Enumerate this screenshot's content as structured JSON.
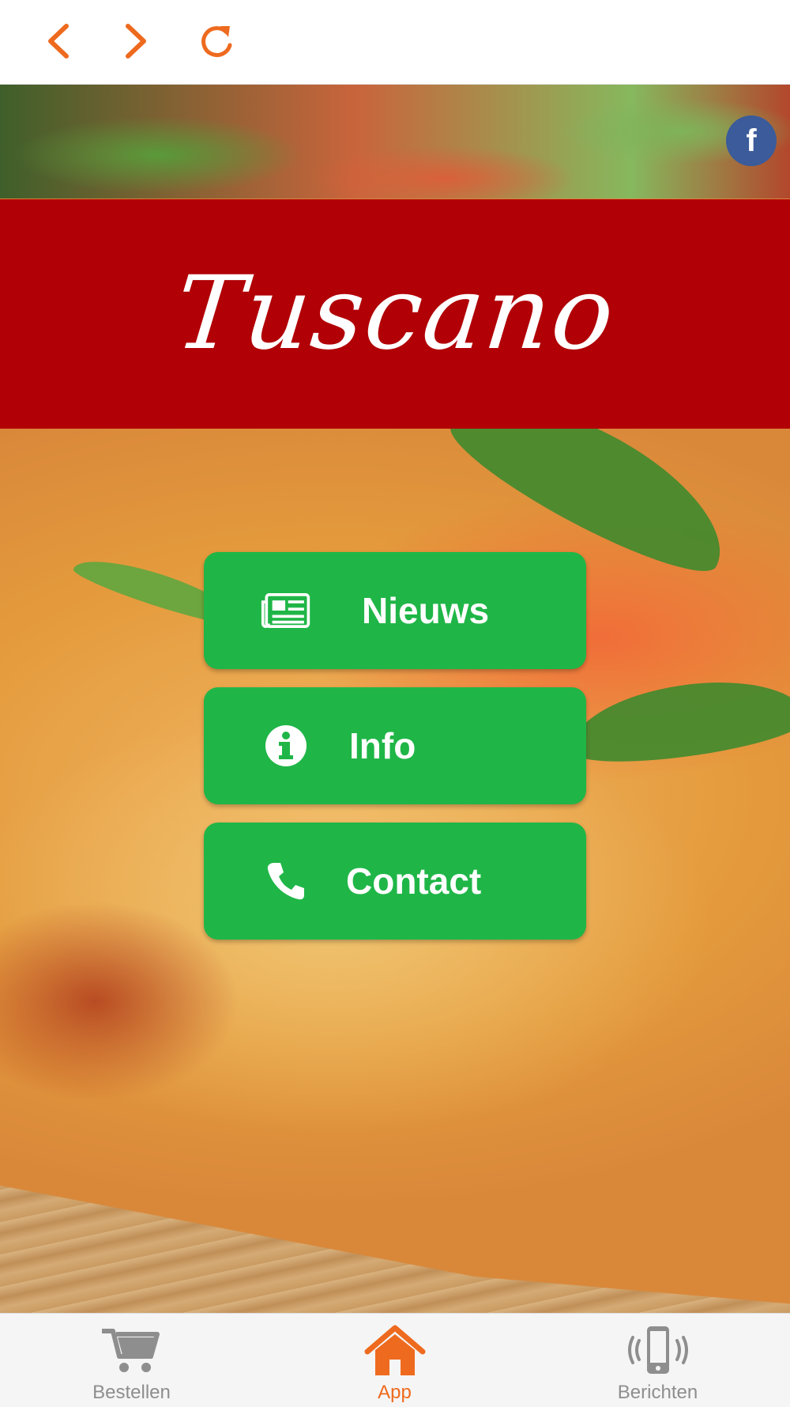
{
  "nav": {
    "back_icon": "chevron-left-icon",
    "forward_icon": "chevron-right-icon",
    "reload_icon": "reload-icon",
    "accent_color": "#ee6a1e"
  },
  "social": {
    "facebook_icon": "facebook-icon",
    "facebook_glyph": "f",
    "color": "#3b5b9a"
  },
  "brand": {
    "name": "Tuscano",
    "banner_color": "#b10006"
  },
  "menu": {
    "button_color": "#1fb647",
    "items": [
      {
        "label": "Nieuws",
        "icon": "newspaper-icon"
      },
      {
        "label": "Info",
        "icon": "info-icon"
      },
      {
        "label": "Contact",
        "icon": "phone-icon"
      }
    ]
  },
  "tabbar": {
    "items": [
      {
        "label": "Bestellen",
        "icon": "cart-icon",
        "active": false
      },
      {
        "label": "App",
        "icon": "home-icon",
        "active": true
      },
      {
        "label": "Berichten",
        "icon": "phone-vibrate-icon",
        "active": false
      }
    ],
    "active_color": "#ee6a1e",
    "inactive_color": "#8e8e8e"
  }
}
